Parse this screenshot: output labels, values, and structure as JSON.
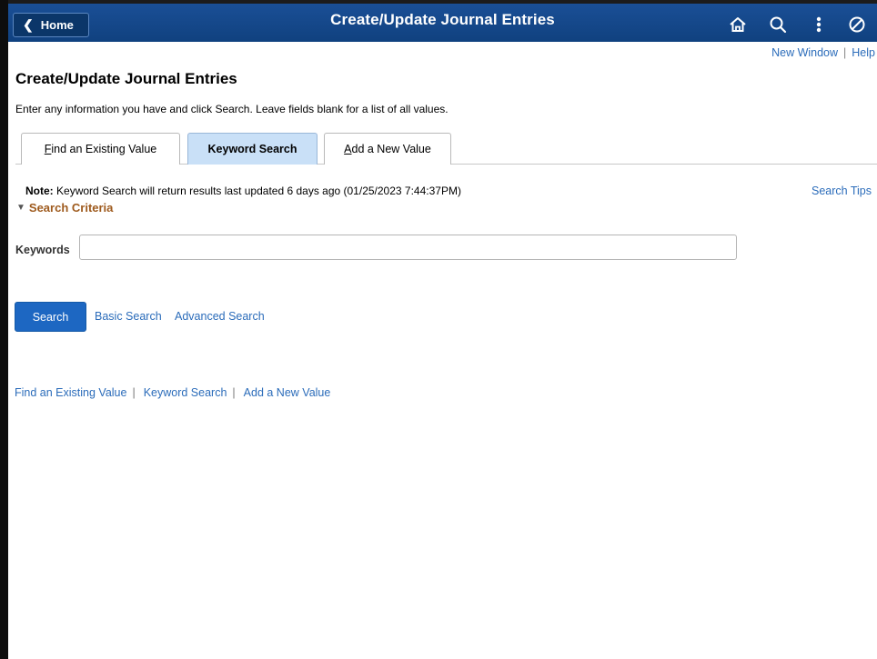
{
  "header": {
    "home_label": "Home",
    "title": "Create/Update Journal Entries",
    "icons": [
      "home-icon",
      "search-icon",
      "actions-menu-icon",
      "navbar-icon"
    ],
    "bg_color": "#12467f"
  },
  "top_links": {
    "new_window": "New Window",
    "separator": "|",
    "help": "Help"
  },
  "page": {
    "title": "Create/Update Journal Entries",
    "instructions": "Enter any information you have and click Search. Leave fields blank for a list of all values."
  },
  "tabs": [
    {
      "label_first": "F",
      "label_rest": "ind an Existing Value",
      "active": false
    },
    {
      "label": "Keyword Search",
      "active": true
    },
    {
      "label_first": "A",
      "label_rest": "dd a New Value",
      "active": false
    }
  ],
  "note": {
    "prefix": "Note:",
    "text": "Keyword Search will return results last updated 6 days ago (01/25/2023 7:44:37PM)"
  },
  "search_tips": "Search Tips",
  "criteria": {
    "label": "Search Criteria",
    "keywords_label": "Keywords",
    "keywords_value": ""
  },
  "actions": {
    "search": "Search",
    "basic_search": "Basic Search",
    "advanced_search": "Advanced Search"
  },
  "bottom_links": {
    "find_existing": "Find an Existing Value",
    "keyword_search": "Keyword Search",
    "add_new": "Add a New Value",
    "separator": "|"
  },
  "colors": {
    "link": "#2b6cba",
    "criteria": "#9e5a1d",
    "search_button": "#1d67c2",
    "active_tab": "#c9e0f7"
  }
}
